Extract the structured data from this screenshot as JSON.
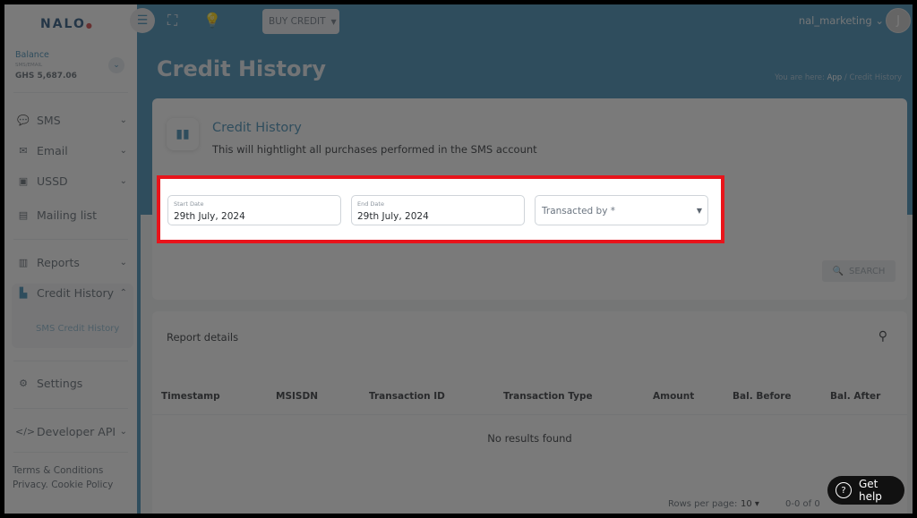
{
  "app": {
    "logo_text": "NALO"
  },
  "topbar": {
    "buy_credit_label": "BUY CREDIT",
    "username": "nal_marketing",
    "avatar_initial": "J",
    "icons": [
      "menu-collapse-icon",
      "fullscreen-icon",
      "lightbulb-icon"
    ]
  },
  "header": {
    "page_title": "Credit History",
    "breadcrumb": {
      "prefix": "You are here:",
      "app": "App",
      "separator": "/",
      "current": "Credit History"
    }
  },
  "sidebar": {
    "balance": {
      "label": "Balance",
      "sub_label": "SMS/EMAIL",
      "value": "GHS 5,687.06"
    },
    "items": [
      {
        "label": "SMS",
        "icon": "sms-icon",
        "has_chevron": true
      },
      {
        "label": "Email",
        "icon": "email-icon",
        "has_chevron": true
      },
      {
        "label": "USSD",
        "icon": "ussd-icon",
        "has_chevron": true
      },
      {
        "label": "Mailing list",
        "icon": "mailing-list-icon",
        "has_chevron": false
      },
      {
        "label": "Reports",
        "icon": "reports-icon",
        "has_chevron": true
      },
      {
        "label": "Credit History",
        "icon": "credit-history-icon",
        "has_chevron": true,
        "expanded": true,
        "active": true
      },
      {
        "label": "Settings",
        "icon": "settings-icon",
        "has_chevron": false
      },
      {
        "label": "Developer API",
        "icon": "code-icon",
        "has_chevron": true
      }
    ],
    "sub_items": [
      {
        "label": "SMS Credit History"
      }
    ],
    "footer": {
      "terms": "Terms & Conditions",
      "privacy": "Privacy. Cookie Policy"
    }
  },
  "filter_card": {
    "title": "Credit History",
    "subtitle": "This will hightlight all purchases performed in the SMS account",
    "start_date": {
      "label": "Start Date",
      "value": "29th July, 2024"
    },
    "end_date": {
      "label": "End Date",
      "value": "29th July, 2024"
    },
    "transacted_by": {
      "placeholder": "Transacted by *",
      "value": ""
    },
    "search_label": "SEARCH"
  },
  "report": {
    "title": "Report details",
    "columns": [
      "Timestamp",
      "MSISDN",
      "Transaction ID",
      "Transaction Type",
      "Amount",
      "Bal. Before",
      "Bal. After"
    ],
    "rows": [],
    "empty_message": "No results found",
    "pagination": {
      "rows_per_page_label": "Rows per page:",
      "rows_per_page": "10",
      "range": "0-0 of 0"
    }
  },
  "help": {
    "label": "Get help"
  },
  "colors": {
    "brand": "#3c88b3",
    "highlight_border": "#e8141b",
    "overlay": "rgba(40,40,40,0.62)"
  }
}
